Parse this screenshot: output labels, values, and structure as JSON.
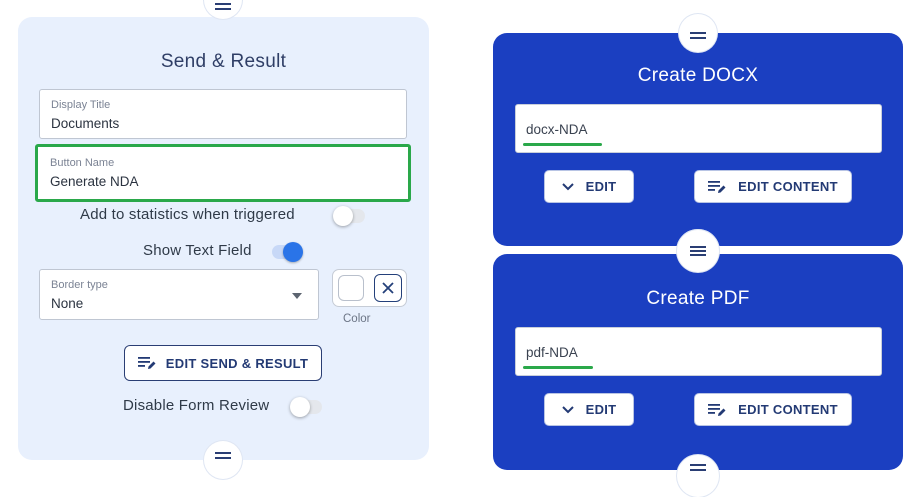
{
  "send_result": {
    "title": "Send & Result",
    "display_title": {
      "label": "Display Title",
      "value": "Documents"
    },
    "button_name": {
      "label": "Button Name",
      "value": "Generate NDA"
    },
    "add_to_statistics_label": "Add to statistics when triggered",
    "add_to_statistics_on": false,
    "show_text_field_label": "Show Text Field",
    "show_text_field_on": true,
    "border_type": {
      "label": "Border type",
      "value": "None"
    },
    "color_label": "Color",
    "edit_button_label": "EDIT SEND & RESULT",
    "disable_form_review_label": "Disable Form Review",
    "disable_form_review_on": false
  },
  "create_docx": {
    "title": "Create DOCX",
    "field_value": "docx-NDA",
    "edit_label": "EDIT",
    "edit_content_label": "EDIT CONTENT"
  },
  "create_pdf": {
    "title": "Create PDF",
    "field_value": "pdf-NDA",
    "edit_label": "EDIT",
    "edit_content_label": "EDIT CONTENT"
  },
  "colors": {
    "left_card_bg": "#e8f0fd",
    "blue_card_bg": "#1b3fc1",
    "highlight_green": "#2aa84a",
    "toggle_on": "#2a74e8",
    "button_text": "#233a74"
  },
  "icons": {
    "handle": "menu-lines-icon",
    "edit_list": "edit-list-icon",
    "chevron": "chevron-down-icon",
    "clear": "close-icon",
    "dropdown": "caret-down-icon"
  }
}
